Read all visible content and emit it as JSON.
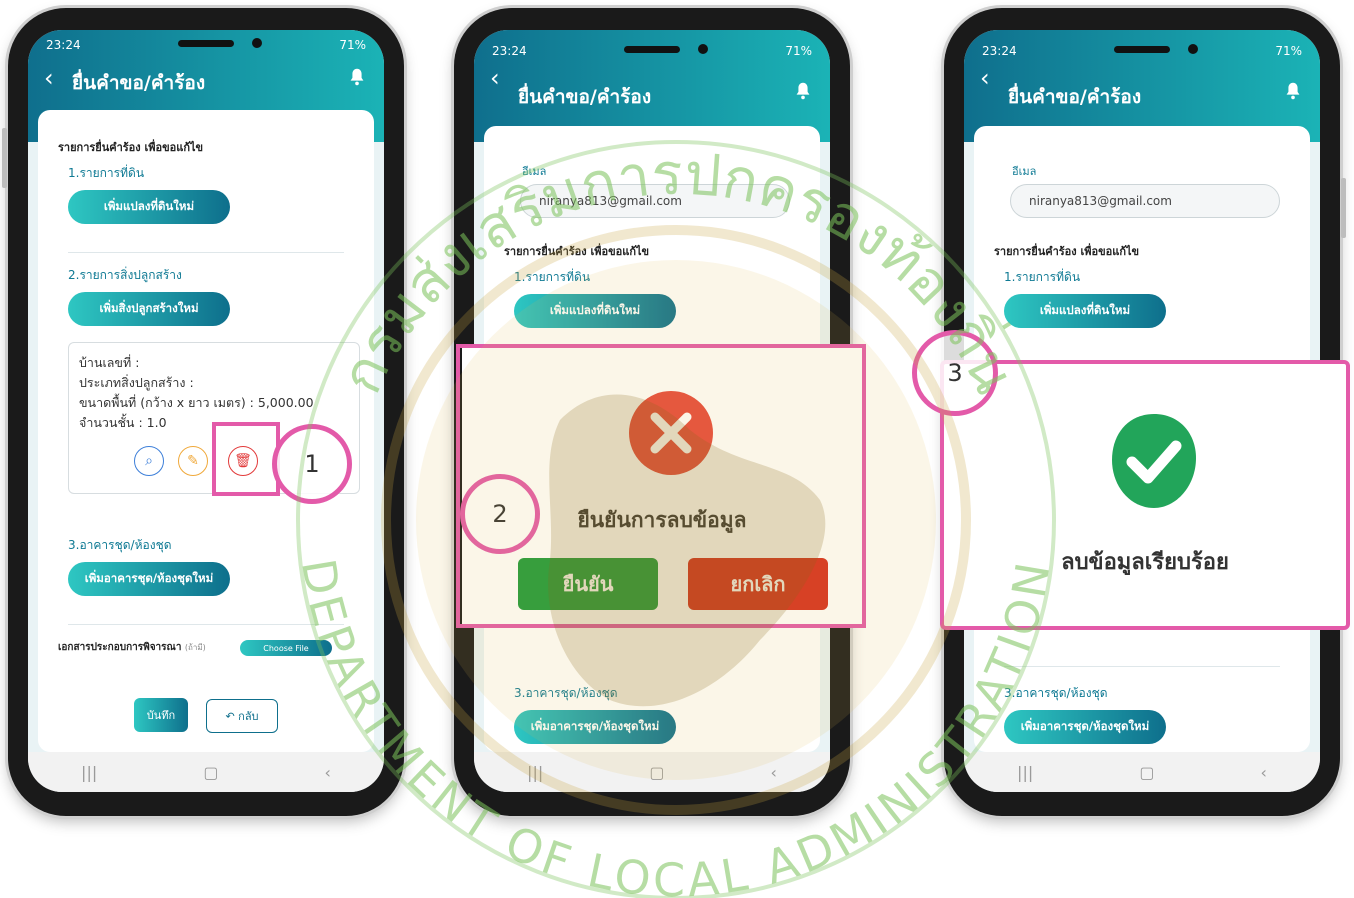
{
  "status": {
    "time": "23:24",
    "battery": "71%"
  },
  "app": {
    "title": "ยื่นคำขอ/คำร้อง"
  },
  "phone1": {
    "section_title": "รายการยื่นคำร้อง เพื่อขอแก้ไข",
    "land_label": "1.รายการที่ดิน",
    "add_land_btn": "เพิ่มแปลงที่ดินใหม่",
    "building_label": "2.รายการสิ่งปลูกสร้าง",
    "add_building_btn": "เพิ่มสิ่งปลูกสร้างใหม่",
    "info": {
      "house_no": "บ้านเลขที่ :",
      "building_type": "ประเภทสิ่งปลูกสร้าง :",
      "area": "ขนาดพื้นที่ (กว้าง x ยาว เมตร) : 5,000.00",
      "floors": "จำนวนชั้น : 1.0"
    },
    "condo_label": "3.อาคารชุด/ห้องชุด",
    "add_condo_btn": "เพิ่มอาคารชุด/ห้องชุดใหม่",
    "docs_label": "เอกสารประกอบการพิจารณา",
    "docs_note": "(ถ้ามี)",
    "choose_file": "Choose File",
    "save_btn": "บันทึก",
    "back_btn": "กลับ"
  },
  "phone2": {
    "email_label": "อีเมล",
    "email_value": "niranya813@gmail.com",
    "section_title": "รายการยื่นคำร้อง เพื่อขอแก้ไข",
    "land_label": "1.รายการที่ดิน",
    "add_land_btn": "เพิ่มแปลงที่ดินใหม่",
    "condo_label": "3.อาคารชุด/ห้องชุด",
    "add_condo_btn": "เพิ่มอาคารชุด/ห้องชุดใหม่",
    "dialog": {
      "message": "ยืนยันการลบข้อมูล",
      "confirm": "ยืนยัน",
      "cancel": "ยกเลิก"
    }
  },
  "phone3": {
    "email_label": "อีเมล",
    "email_value": "niranya813@gmail.com",
    "section_title": "รายการยื่นคำร้อง เพื่อขอแก้ไข",
    "land_label": "1.รายการที่ดิน",
    "add_land_btn": "เพิ่มแปลงที่ดินใหม่",
    "condo_label": "3.อาคารชุด/ห้องชุด",
    "add_condo_btn": "เพิ่มอาคารชุด/ห้องชุดใหม่",
    "dialog": {
      "message": "ลบข้อมูลเรียบร้อย"
    }
  },
  "steps": [
    "1",
    "2",
    "3"
  ],
  "watermark": {
    "thai_text": "กรมส่งเสริมการปกครองท้องถิ่น",
    "english_text": "DEPARTMENT OF LOCAL ADMINISTRATION"
  },
  "nav_icons": [
    "recent-apps-icon",
    "home-icon",
    "back-icon"
  ],
  "colors": {
    "teal_dark": "#0e6f8c",
    "teal_light": "#2ec7c2",
    "pink_highlight": "#e35aa9",
    "confirm_green": "#1e9a3b",
    "cancel_red": "#d6301f",
    "success_green": "#22a55a",
    "error_red": "#e64a3c"
  }
}
